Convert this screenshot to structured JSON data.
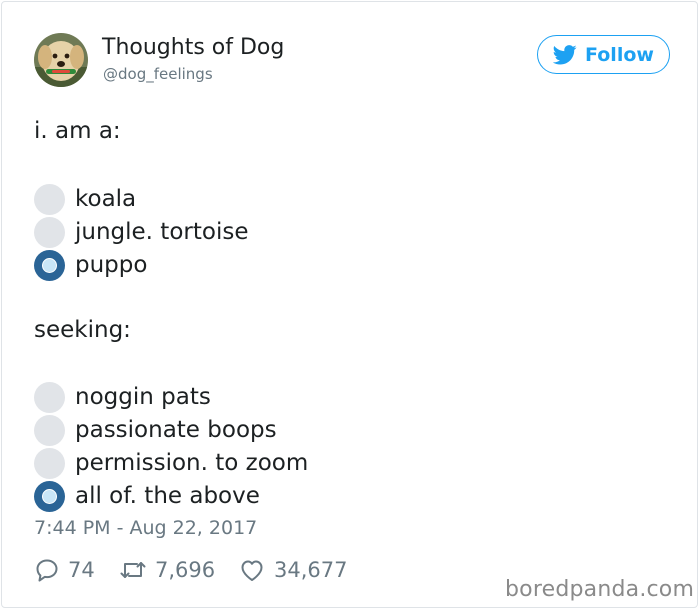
{
  "author": {
    "display_name": "Thoughts of Dog",
    "handle": "@dog_feelings"
  },
  "follow_button": {
    "label": "Follow",
    "icon": "twitter-bird-icon"
  },
  "tweet": {
    "line1": "i. am a:",
    "options_a": [
      {
        "label": "koala",
        "selected": false
      },
      {
        "label": "jungle. tortoise",
        "selected": false
      },
      {
        "label": "puppo",
        "selected": true
      }
    ],
    "line2": "seeking:",
    "options_b": [
      {
        "label": "noggin pats",
        "selected": false
      },
      {
        "label": "passionate boops",
        "selected": false
      },
      {
        "label": "permission. to zoom",
        "selected": false
      },
      {
        "label": "all of. the above",
        "selected": true
      }
    ],
    "timestamp": "7:44 PM - Aug 22, 2017"
  },
  "actions": {
    "replies": "74",
    "retweets": "7,696",
    "likes": "34,677"
  },
  "watermark": "boredpanda.com",
  "colors": {
    "accent": "#1da1f2",
    "radio_selected": "#2a6496",
    "radio_empty": "#e1e4e8",
    "muted_text": "#697882"
  }
}
